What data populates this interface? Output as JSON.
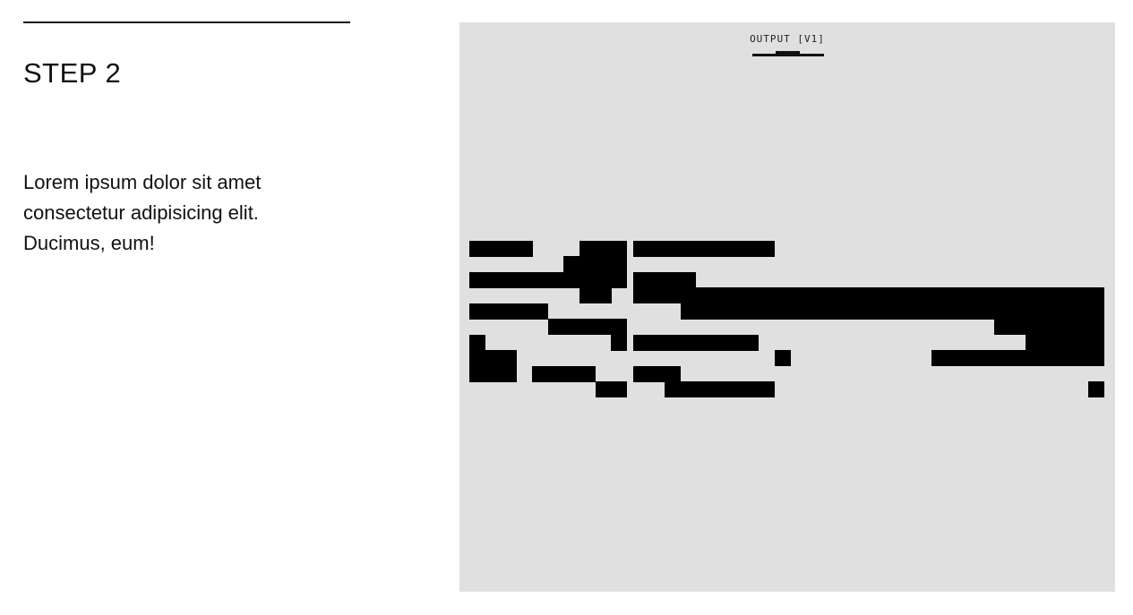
{
  "step": {
    "title": "STEP 2",
    "body": "Lorem ipsum dolor sit amet consectetur adipisicing elit. Ducimus, eum!"
  },
  "output": {
    "label": "OUTPUT [V1]",
    "background": "#e0e0e0",
    "fill_color": "#000000"
  }
}
